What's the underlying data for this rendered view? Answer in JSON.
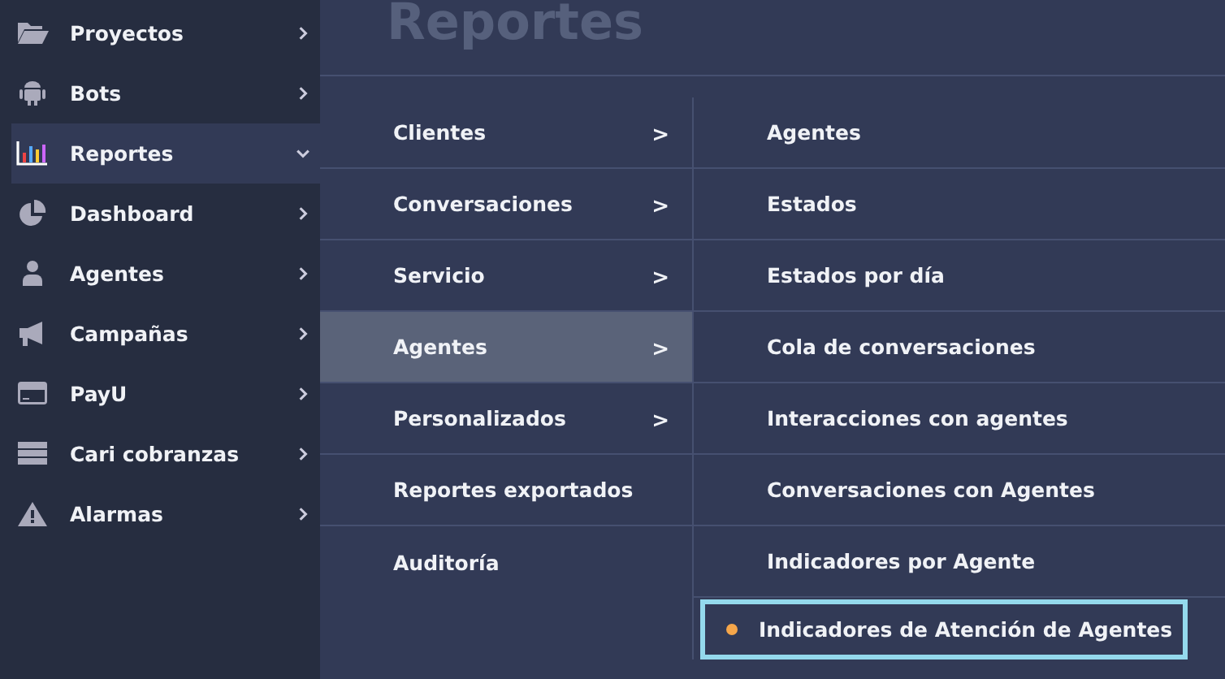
{
  "sidebar": {
    "items": [
      {
        "label": "Proyectos",
        "selected": false,
        "expanded": false
      },
      {
        "label": "Bots",
        "selected": false,
        "expanded": false
      },
      {
        "label": "Reportes",
        "selected": true,
        "expanded": true
      },
      {
        "label": "Dashboard",
        "selected": false,
        "expanded": false
      },
      {
        "label": "Agentes",
        "selected": false,
        "expanded": false
      },
      {
        "label": "Campañas",
        "selected": false,
        "expanded": false
      },
      {
        "label": "PayU",
        "selected": false,
        "expanded": false
      },
      {
        "label": "Cari cobranzas",
        "selected": false,
        "expanded": false
      },
      {
        "label": "Alarmas",
        "selected": false,
        "expanded": false
      }
    ]
  },
  "page_title": "Reportes",
  "categories": [
    {
      "label": "Clientes",
      "chevron": ">",
      "selected": false
    },
    {
      "label": "Conversaciones",
      "chevron": ">",
      "selected": false
    },
    {
      "label": "Servicio",
      "chevron": ">",
      "selected": false
    },
    {
      "label": "Agentes",
      "chevron": ">",
      "selected": true
    },
    {
      "label": "Personalizados",
      "chevron": ">",
      "selected": false
    },
    {
      "label": "Reportes exportados",
      "selected": false
    },
    {
      "label": "Auditoría",
      "selected": false
    }
  ],
  "reports": [
    {
      "label": "Agentes",
      "selected": false
    },
    {
      "label": "Estados",
      "selected": false
    },
    {
      "label": "Estados por día",
      "selected": false
    },
    {
      "label": "Cola de conversaciones",
      "selected": false
    },
    {
      "label": "Interacciones con agentes",
      "selected": false
    },
    {
      "label": "Conversaciones con Agentes",
      "selected": false
    },
    {
      "label": "Indicadores por Agente",
      "selected": false
    },
    {
      "label": "Indicadores de Atención de Agentes",
      "selected": true
    }
  ]
}
